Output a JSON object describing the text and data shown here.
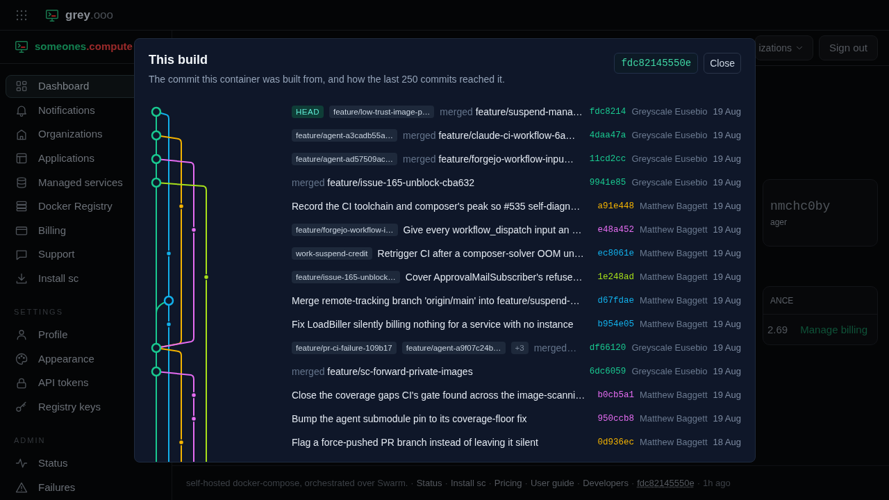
{
  "topbar": {
    "brand": "grey",
    "brand_suffix": ".ooo"
  },
  "org": {
    "name": "someones",
    "suffix": ".compute"
  },
  "sidebar": {
    "sections": [
      {
        "items": [
          {
            "label": "Dashboard",
            "selected": true
          },
          {
            "label": "Notifications",
            "selected": false
          },
          {
            "label": "Organizations",
            "selected": false
          },
          {
            "label": "Applications",
            "selected": false
          },
          {
            "label": "Managed services",
            "selected": false
          },
          {
            "label": "Docker Registry",
            "selected": false
          },
          {
            "label": "Billing",
            "selected": false
          },
          {
            "label": "Support",
            "selected": false
          },
          {
            "label": "Install sc",
            "selected": false
          }
        ]
      },
      {
        "heading": "SETTINGS",
        "items": [
          {
            "label": "Profile",
            "selected": false
          },
          {
            "label": "Appearance",
            "selected": false
          },
          {
            "label": "API tokens",
            "selected": false
          },
          {
            "label": "Registry keys",
            "selected": false
          }
        ]
      },
      {
        "heading": "ADMIN",
        "items": [
          {
            "label": "Status",
            "selected": false
          },
          {
            "label": "Failures",
            "selected": false
          }
        ]
      }
    ]
  },
  "header_buttons": [
    {
      "label": "izations",
      "kind": "dropdown"
    },
    {
      "label": "Sign out",
      "kind": "button"
    }
  ],
  "account_card": {
    "value": "nmchc0by",
    "caption": "ager"
  },
  "billing_card": {
    "heading": "ANCE",
    "amount": "2.69",
    "link": "Manage billing"
  },
  "footer": {
    "separator": "·",
    "parts": [
      {
        "text": "self-hosted docker-compose, orchestrated over Swarm.",
        "kind": "text"
      },
      {
        "text": "Status",
        "kind": "link"
      },
      {
        "text": "Install sc",
        "kind": "link"
      },
      {
        "text": "Pricing",
        "kind": "link"
      },
      {
        "text": "User guide",
        "kind": "link"
      },
      {
        "text": "Developers",
        "kind": "link"
      },
      {
        "text": "fdc82145550e",
        "kind": "commit"
      },
      {
        "text": "1h ago",
        "kind": "text"
      }
    ]
  },
  "modal": {
    "title": "This build",
    "subtitle": "The commit this container was built from, and how the last 250 commits reached it.",
    "commit": "fdc82145550e",
    "close": "Close"
  },
  "commits": [
    {
      "refs": [
        {
          "label": "HEAD",
          "kind": "head"
        },
        {
          "label": "feature/low-trust-image-p…",
          "kind": "branch"
        }
      ],
      "prefix": "merged",
      "message": "feature/suspend-mana…",
      "hash": "fdc8214",
      "color": "#19c990",
      "author": "Greyscale Eusebio",
      "date": "19 Aug",
      "kind": "merge"
    },
    {
      "refs": [
        {
          "label": "feature/agent-a3cadb55a…",
          "kind": "branch"
        }
      ],
      "prefix": "merged",
      "message": "feature/claude-ci-workflow-6a…",
      "hash": "4daa47a",
      "color": "#19c990",
      "author": "Greyscale Eusebio",
      "date": "19 Aug",
      "kind": "merge"
    },
    {
      "refs": [
        {
          "label": "feature/agent-ad57509ac…",
          "kind": "branch"
        }
      ],
      "prefix": "merged",
      "message": "feature/forgejo-workflow-inpu…",
      "hash": "11cd2cc",
      "color": "#19c990",
      "author": "Greyscale Eusebio",
      "date": "19 Aug",
      "kind": "merge"
    },
    {
      "prefix": "merged",
      "message": "feature/issue-165-unblock-cba632",
      "hash": "9941e85",
      "color": "#19c990",
      "author": "Greyscale Eusebio",
      "date": "19 Aug",
      "kind": "merge"
    },
    {
      "message": "Record the CI toolchain and composer's peak so #535 self-diagn…",
      "hash": "a91e448",
      "color": "#f5b400",
      "author": "Matthew Baggett",
      "date": "19 Aug",
      "kind": "commit"
    },
    {
      "refs": [
        {
          "label": "feature/forgejo-workflow-i…",
          "kind": "branch"
        }
      ],
      "message": "Give every workflow_dispatch input an …",
      "hash": "e48a452",
      "color": "#e66cf2",
      "author": "Matthew Baggett",
      "date": "19 Aug",
      "kind": "commit"
    },
    {
      "refs": [
        {
          "label": "work-suspend-credit",
          "kind": "branch"
        }
      ],
      "message": "Retrigger CI after a composer-solver OOM un…",
      "hash": "ec8061e",
      "color": "#12b1ec",
      "author": "Matthew Baggett",
      "date": "19 Aug",
      "kind": "commit"
    },
    {
      "refs": [
        {
          "label": "feature/issue-165-unblock…",
          "kind": "branch"
        }
      ],
      "message": "Cover ApprovalMailSubscriber's refuse…",
      "hash": "1e248ad",
      "color": "#a8e01a",
      "author": "Matthew Baggett",
      "date": "19 Aug",
      "kind": "commit"
    },
    {
      "message": "Merge remote-tracking branch 'origin/main' into feature/suspend-…",
      "hash": "d67fdae",
      "color": "#12b1ec",
      "author": "Matthew Baggett",
      "date": "19 Aug",
      "kind": "merge"
    },
    {
      "message": "Fix LoadBiller silently billing nothing for a service with no instance",
      "hash": "b954e05",
      "color": "#12b1ec",
      "author": "Matthew Baggett",
      "date": "19 Aug",
      "kind": "commit"
    },
    {
      "refs": [
        {
          "label": "feature/pr-ci-failure-109b17",
          "kind": "branch"
        },
        {
          "label": "feature/agent-a9f07c24b…",
          "kind": "branch"
        },
        {
          "label": "+3",
          "kind": "more"
        }
      ],
      "prefix": "merged…",
      "hash": "df66120",
      "color": "#19c990",
      "author": "Greyscale Eusebio",
      "date": "19 Aug",
      "kind": "merge"
    },
    {
      "prefix": "merged",
      "message": "feature/sc-forward-private-images",
      "hash": "6dc6059",
      "color": "#19c990",
      "author": "Greyscale Eusebio",
      "date": "19 Aug",
      "kind": "merge"
    },
    {
      "message": "Close the coverage gaps CI's gate found across the image-scanni…",
      "hash": "b0cb5a1",
      "color": "#e66cf2",
      "author": "Matthew Baggett",
      "date": "19 Aug",
      "kind": "commit"
    },
    {
      "message": "Bump the agent submodule pin to its coverage-floor fix",
      "hash": "950ccb8",
      "color": "#e66cf2",
      "author": "Matthew Baggett",
      "date": "19 Aug",
      "kind": "commit"
    },
    {
      "message": "Flag a force-pushed PR branch instead of leaving it silent",
      "hash": "0d936ec",
      "color": "#f5b400",
      "author": "Matthew Baggett",
      "date": "18 Aug",
      "kind": "commit"
    }
  ]
}
